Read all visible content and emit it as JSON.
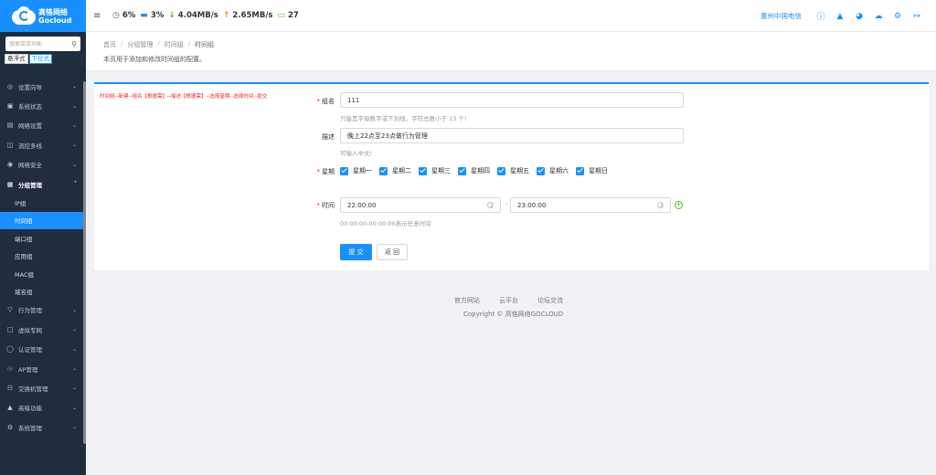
{
  "brand": {
    "name_cn": "高恪网络",
    "name_en": "Gocloud"
  },
  "sidebar": {
    "search_placeholder": "搜索菜单功能",
    "modes": [
      "悬浮式",
      "下拉式"
    ],
    "items": [
      {
        "label": "设置向导",
        "icon": "compass-icon"
      },
      {
        "label": "系统状态",
        "icon": "monitor-icon"
      },
      {
        "label": "网络设置",
        "icon": "network-icon"
      },
      {
        "label": "流控多线",
        "icon": "flow-icon"
      },
      {
        "label": "网络安全",
        "icon": "shield-icon"
      },
      {
        "label": "分组管理",
        "icon": "group-icon"
      },
      {
        "label": "行为管理",
        "icon": "filter-icon"
      },
      {
        "label": "虚拟专网",
        "icon": "vpn-icon"
      },
      {
        "label": "认证管理",
        "icon": "auth-icon"
      },
      {
        "label": "AP管理",
        "icon": "ap-icon"
      },
      {
        "label": "交换机管理",
        "icon": "switch-icon"
      },
      {
        "label": "高级功能",
        "icon": "advanced-icon"
      },
      {
        "label": "系统管理",
        "icon": "gear-icon"
      }
    ],
    "sub_items": [
      "IP组",
      "时间组",
      "端口组",
      "应用组",
      "MAC组",
      "域名组"
    ]
  },
  "topbar": {
    "cpu": "6%",
    "mem": "3%",
    "down": "4.04MB/s",
    "up": "2.65MB/s",
    "devices": "27",
    "isp": "惠州中国电信"
  },
  "breadcrumb": [
    "首页",
    "分组管理",
    "时间组",
    "时间组"
  ],
  "page_desc": "本页用于添加和修改时间组的配置。",
  "hint": "时间组--新建--组名【根据需】--描述【根据需】--选择星期--选择时间--提交",
  "form": {
    "name_label": "组名",
    "name_value": "111",
    "name_help": "只能是字母数字或下划线，字符总数小于 13 个!",
    "desc_label": "描述",
    "desc_value": "晚上22点至23点做行为管理",
    "desc_help": "可输入中文!",
    "week_label": "星期",
    "weekdays": [
      "星期一",
      "星期二",
      "星期三",
      "星期四",
      "星期五",
      "星期六",
      "星期日"
    ],
    "time_label": "时间",
    "time_start": "22:00:00",
    "time_end": "23:00:00",
    "time_sep": "-",
    "time_help": "00:00:00-00:00:00表示任意时间",
    "submit": "提 交",
    "back": "返 回"
  },
  "footer": {
    "links": [
      "官方网站",
      "云平台",
      "论坛交流"
    ],
    "copyright": "Copyright © 高恪网络GOCLOUD"
  }
}
